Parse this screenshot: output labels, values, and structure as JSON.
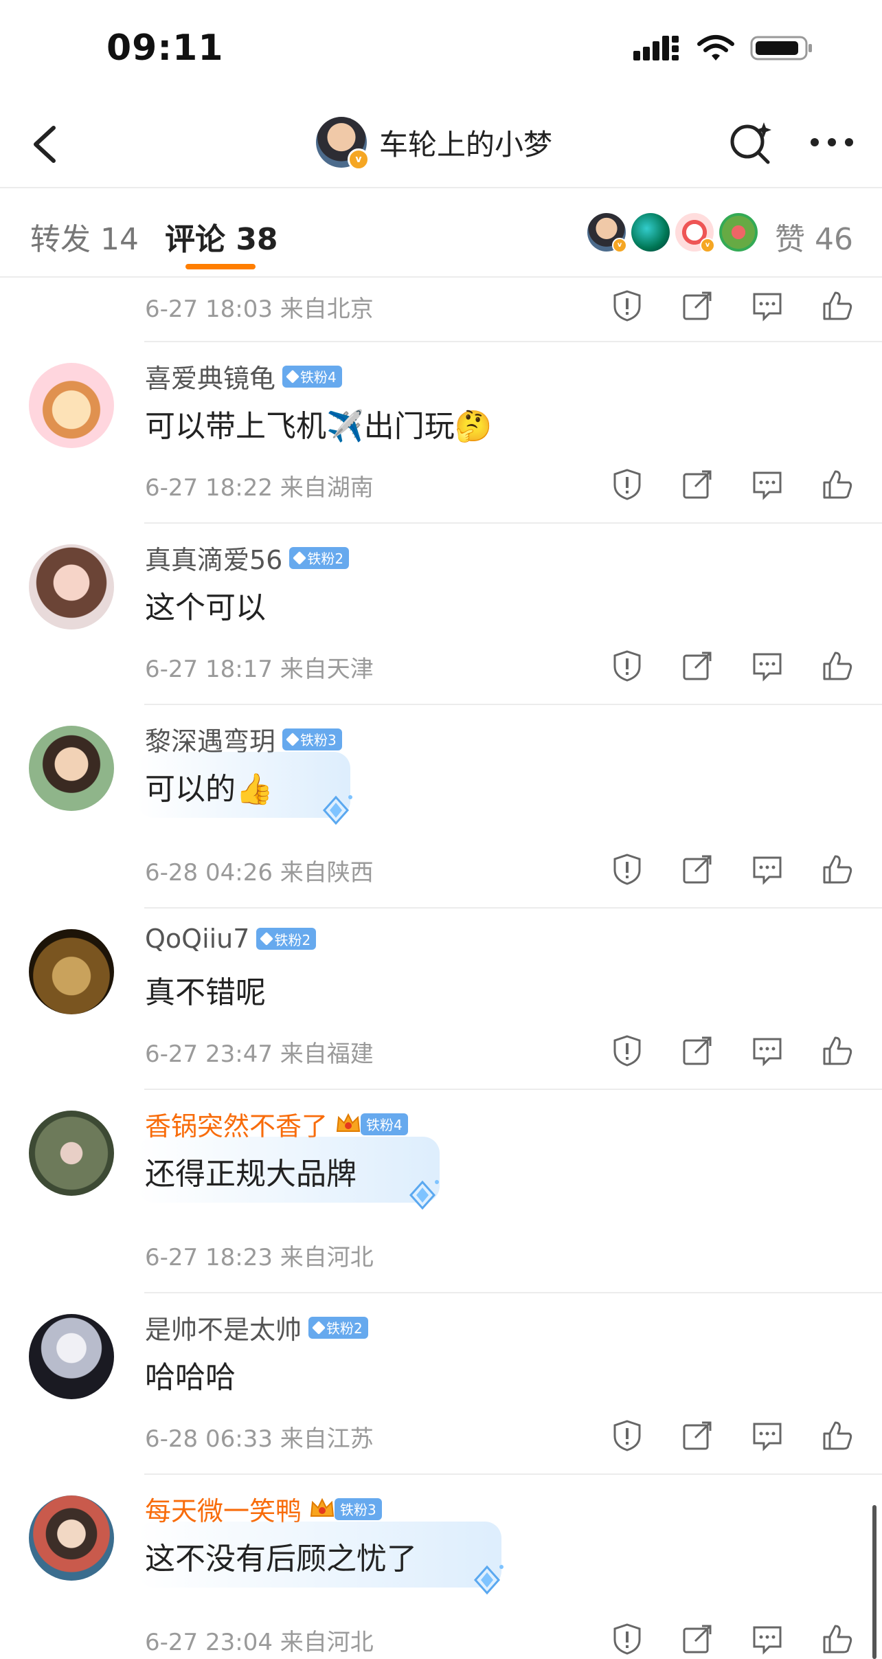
{
  "status_bar": {
    "time": "09:11"
  },
  "nav": {
    "title": "车轮上的小梦"
  },
  "tabs": {
    "repost": "转发 14",
    "comment": "评论 38",
    "likes": "赞 46"
  },
  "colors": {
    "accent": "#ff7e00",
    "vip_name": "#f86c0b",
    "fan_badge": "#66a9ee"
  },
  "top_row": {
    "meta": "6-27 18:03  来自北京"
  },
  "comments": [
    {
      "user": "喜爱典镜龟",
      "fan_badge": "铁粉4",
      "text": "可以带上飞机✈️出门玩🤔",
      "meta": "6-27 18:22  来自湖南",
      "avatar": "cartoon-tiger-girl"
    },
    {
      "user": "真真滴爱56",
      "fan_badge": "铁粉2",
      "text": "这个可以",
      "meta": "6-27 18:17  来自天津",
      "avatar": "doll-girl"
    },
    {
      "user": "黎深遇弯玥",
      "fan_badge": "铁粉3",
      "text": "可以的👍",
      "meta": "6-28 04:26  来自陕西",
      "avatar": "girl-photo"
    },
    {
      "user": "QoQiiu7",
      "fan_badge": "铁粉2",
      "text": "真不错呢",
      "meta": "6-27 23:47  来自福建",
      "avatar": "frog-face"
    },
    {
      "user": "香锅突然不香了",
      "fan_badge": "铁粉4",
      "text": "还得正规大品牌",
      "meta": "6-27 18:23  来自河北",
      "avatar": "outdoor-photo"
    },
    {
      "user": "是帅不是太帅",
      "fan_badge": "铁粉2",
      "text": "哈哈哈",
      "meta": "6-28 06:33  来自江苏",
      "avatar": "anime-boy"
    },
    {
      "user": "每天微一笑鸭",
      "fan_badge": "铁粉3",
      "text": "这不没有后顾之忧了",
      "meta": "6-27 23:04  来自河北",
      "avatar": "anime-boy-graffiti"
    }
  ],
  "icons": {
    "report": "shield-exclamation-icon",
    "share": "share-out-icon",
    "reply": "comment-bubble-icon",
    "like": "thumbs-up-icon"
  }
}
